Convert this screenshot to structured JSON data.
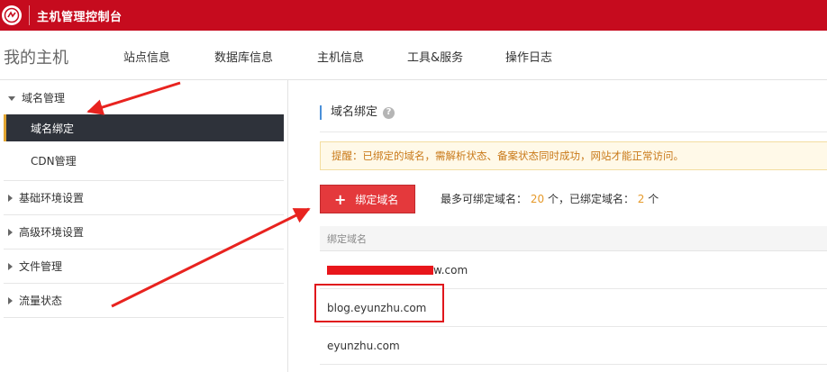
{
  "topbar": {
    "logo_icon": "brand-logo-icon",
    "title": "主机管理控制台",
    "bg_color": "#c60b1e"
  },
  "nav": {
    "brand": "我的主机",
    "items": [
      {
        "label": "站点信息"
      },
      {
        "label": "数据库信息"
      },
      {
        "label": "主机信息"
      },
      {
        "label": "工具&服务"
      },
      {
        "label": "操作日志"
      }
    ]
  },
  "sidebar": {
    "groups": [
      {
        "label": "域名管理",
        "expanded": true,
        "caret_icon": "caret-down-icon"
      },
      {
        "label": "基础环境设置",
        "expanded": false,
        "caret_icon": "caret-right-icon"
      },
      {
        "label": "高级环境设置",
        "expanded": false,
        "caret_icon": "caret-right-icon"
      },
      {
        "label": "文件管理",
        "expanded": false,
        "caret_icon": "caret-right-icon"
      },
      {
        "label": "流量状态",
        "expanded": false,
        "caret_icon": "caret-right-icon"
      }
    ],
    "subitems": [
      {
        "label": "域名绑定",
        "active": true
      },
      {
        "label": "CDN管理",
        "active": false
      }
    ],
    "active_color": "#2e323a",
    "active_accent": "#e2a531"
  },
  "main": {
    "section_title": "域名绑定",
    "help_icon": "question-circle-icon",
    "help_glyph": "?",
    "notice": "提醒：已绑定的域名，需解析状态、备案状态同时成功，网站才能正常访问。",
    "bind_button": {
      "icon": "plus-icon",
      "glyph": "+",
      "label": "绑定域名"
    },
    "limit": {
      "prefix": "最多可绑定域名：",
      "max": "20",
      "middle": "个，已绑定域名：",
      "bound": "2",
      "suffix": "个"
    },
    "table": {
      "header": "绑定域名",
      "rows": [
        {
          "domain_visible": "w.com",
          "redacted": true
        },
        {
          "domain_visible": "blog.eyunzhu.com",
          "redacted": false
        },
        {
          "domain_visible": "eyunzhu.com",
          "redacted": false
        }
      ]
    }
  },
  "colors": {
    "accent_red": "#e4393c",
    "notice_text": "#c97a1a",
    "notice_bg": "#fff9e8",
    "count_orange": "#e69a2b",
    "annotation_red": "#e0161c"
  }
}
